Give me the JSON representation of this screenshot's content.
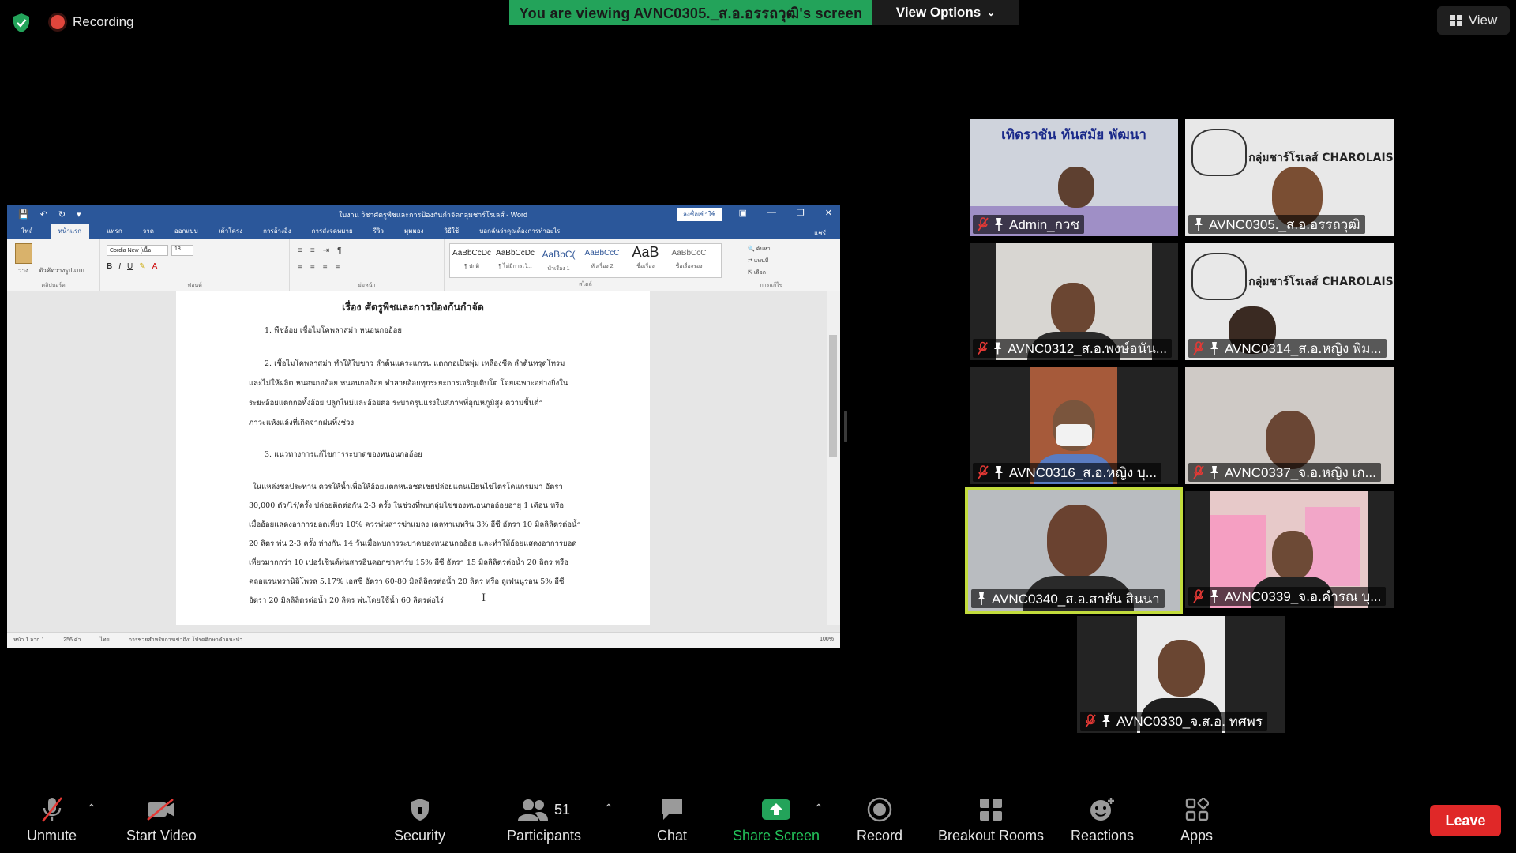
{
  "top_bar": {
    "recording_label": "Recording",
    "viewing_banner": "You are viewing AVNC0305._ส.อ.อรรถวุฒิ's screen",
    "view_options_label": "View Options",
    "view_label": "View"
  },
  "word": {
    "window_title": "ใบงาน วิชาศัตรูพืชและการป้องกันกำจัดกลุ่มชาร์โรเลส์ - Word",
    "signin_label": "ลงชื่อเข้าใช้",
    "tabs": [
      "ไฟล์",
      "หน้าแรก",
      "แทรก",
      "วาด",
      "ออกแบบ",
      "เค้าโครง",
      "การอ้างอิง",
      "การส่งจดหมาย",
      "รีวิว",
      "มุมมอง",
      "วิธีใช้",
      "บอกฉันว่าคุณต้องการทำอะไร"
    ],
    "share_label": "แชร์",
    "ribbon": {
      "clipboard_label": "คลิปบอร์ด",
      "font_label": "ฟอนต์",
      "paragraph_label": "ย่อหน้า",
      "styles_label": "สไตล์",
      "editing_label": "การแก้ไข",
      "font_name": "Cordia New (เนื้อ",
      "font_size": "18",
      "paste_label": "วาง",
      "format_painter": "ตัวคัดวางรูปแบบ",
      "find_label": "ค้นหา",
      "replace_label": "แทนที่",
      "select_label": "เลือก",
      "styles": [
        {
          "preview": "AaBbCcDc",
          "name": "¶ ปกติ"
        },
        {
          "preview": "AaBbCcDc",
          "name": "¶ ไม่มีการเว้..."
        },
        {
          "preview": "AaBbC(",
          "name": "หัวเรื่อง 1"
        },
        {
          "preview": "AaBbCcC",
          "name": "หัวเรื่อง 2"
        },
        {
          "preview": "AaB",
          "name": "ชื่อเรื่อง"
        },
        {
          "preview": "AaBbCcC",
          "name": "ชื่อเรื่องรอง"
        }
      ]
    },
    "document": {
      "title": "เรื่อง ศัตรูพืชและการป้องกันกำจัด",
      "para1": "1. พืชอ้อย เชื้อไมโคพลาสม่า หนอนกออ้อย",
      "para2_l1": "2. เชื้อไมโคพลาสม่า ทำให้ใบขาว ลำต้นแคระแกรน แตกกอเป็นพุ่ม เหลืองซีด ลำต้นทรุดโทรม",
      "para2_l2": "และไม่ให้ผลิต หนอนกออ้อย หนอนกออ้อย ทำลายอ้อยทุกระยะการเจริญเติบโต โดยเฉพาะอย่างยิ่งใน",
      "para2_l3": "ระยะอ้อยแตกกอทั้งอ้อย ปลูกใหม่และอ้อยตอ ระบาดรุนแรงในสภาพที่อุณหภูมิสูง ความชื้นต่ำ",
      "para2_l4": "ภาวะแห้งแล้งที่เกิดจากฝนทิ้งช่วง",
      "para3": "3. แนวทางการแก้ไขการระบาดของหนอนกออ้อย",
      "para4_l1": "ในแหล่งชลประทาน ควรให้น้ำเพื่อให้อ้อยแตกหน่อชดเชยปล่อยแตนเบียนไข่ไตรโคแกรมมา อัตรา",
      "para4_l2": "30,000 ตัว/ไร่/ครั้ง ปล่อยติดต่อกัน 2-3 ครั้ง ในช่วงที่พบกลุ่มไข่ของหนอนกออ้อยอายุ 1 เดือน หรือ",
      "para4_l3": "เมื่ออ้อยแสดงอาการยอดเหี่ยว 10% ควรพ่นสารฆ่าแมลง เดลทาเมทริน 3% อีซี อัตรา 10 มิลลิลิตรต่อน้ำ",
      "para4_l4": "20 ลิตร พ่น 2-3 ครั้ง ห่างกัน 14 วันเมื่อพบการระบาดของหนอนกออ้อย และทำให้อ้อยแสดงอาการยอด",
      "para4_l5": "เหี่ยวมากกว่า 10 เปอร์เซ็นต์พ่นสารอินดอกซาคาร์บ 15% อีซี อัตรา 15 มิลลิลิตรต่อน้ำ 20 ลิตร หรือ",
      "para4_l6": "คลอแรนทรานิลิโพรล 5.17% เอสซี อัตรา 60-80 มิลลิลิตรต่อน้ำ 20 ลิตร หรือ ลูเฟนนูรอน 5% อีซี",
      "para4_l7": "อัตรา 20 มิลลิลิตรต่อน้ำ 20 ลิตร พ่นโดยใช้น้ำ 60 ลิตรต่อไร่"
    },
    "status": {
      "page": "หน้า 1 จาก 1",
      "words": "256 คำ",
      "language": "ไทย",
      "accessibility": "การช่วยสำหรับการเข้าถึง: โปรดศึกษาคำแนะนำ",
      "zoom": "100%"
    }
  },
  "participants": [
    {
      "name": "Admin_กวช",
      "muted": true,
      "banner": "เทิดราชัน    ทันสมัย    พัฒนา"
    },
    {
      "name": "AVNC0305._ส.อ.อรรถวุฒิ",
      "muted": false,
      "banner": "กลุ่มชาร์โรเลส์ CHAROLAIS"
    },
    {
      "name": "AVNC0312_ส.อ.พงษ์อนัน...",
      "muted": true
    },
    {
      "name": "AVNC0314_ส.อ.หญิง พิม...",
      "muted": true,
      "banner": "กลุ่มชาร์โรเลส์ CHAROLAIS"
    },
    {
      "name": "AVNC0316_ส.อ.หญิง บุ...",
      "muted": true
    },
    {
      "name": "AVNC0337_จ.อ.หญิง เก...",
      "muted": true
    },
    {
      "name": "AVNC0340_ส.อ.สายัน สินนา",
      "muted": false
    },
    {
      "name": "AVNC0339_จ.อ.คำรณ บุ...",
      "muted": true
    },
    {
      "name": "AVNC0330_จ.ส.อ. ทศพร",
      "muted": true
    }
  ],
  "toolbar": {
    "unmute": "Unmute",
    "start_video": "Start Video",
    "security": "Security",
    "participants": "Participants",
    "participants_count": "51",
    "chat": "Chat",
    "share_screen": "Share Screen",
    "record": "Record",
    "breakout_rooms": "Breakout Rooms",
    "reactions": "Reactions",
    "apps": "Apps",
    "leave": "Leave"
  },
  "colors": {
    "share_green": "#23a35a",
    "leave_red": "#e02828",
    "word_blue": "#2b579a",
    "active_speaker": "#c2dc3c"
  }
}
